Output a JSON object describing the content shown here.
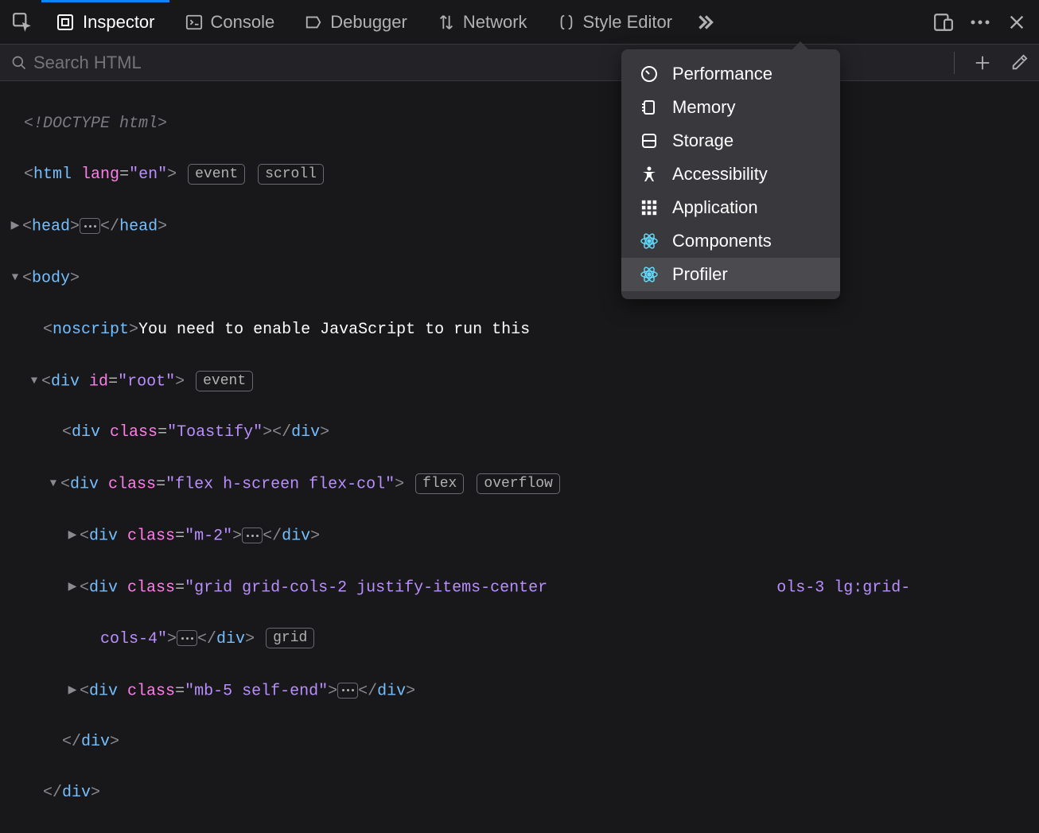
{
  "toolbar": {
    "tabs": [
      {
        "id": "inspector",
        "label": "Inspector",
        "active": true
      },
      {
        "id": "console",
        "label": "Console",
        "active": false
      },
      {
        "id": "debugger",
        "label": "Debugger",
        "active": false
      },
      {
        "id": "network",
        "label": "Network",
        "active": false
      },
      {
        "id": "styleeditor",
        "label": "Style Editor",
        "active": false
      }
    ]
  },
  "search": {
    "placeholder": "Search HTML"
  },
  "overflow_menu": {
    "items": [
      {
        "id": "performance",
        "label": "Performance",
        "icon": "gauge"
      },
      {
        "id": "memory",
        "label": "Memory",
        "icon": "memory"
      },
      {
        "id": "storage",
        "label": "Storage",
        "icon": "storage"
      },
      {
        "id": "accessibility",
        "label": "Accessibility",
        "icon": "accessibility"
      },
      {
        "id": "application",
        "label": "Application",
        "icon": "grid"
      },
      {
        "id": "components",
        "label": "Components",
        "icon": "react"
      },
      {
        "id": "profiler",
        "label": "Profiler",
        "icon": "react",
        "hover": true
      }
    ]
  },
  "markup": {
    "doctype": "<!DOCTYPE html>",
    "html_open": {
      "tag": "html",
      "attrs": [
        {
          "name": "lang",
          "value": "\"en\""
        }
      ],
      "badges": [
        "event",
        "scroll"
      ]
    },
    "head": {
      "tag": "head"
    },
    "body_open": {
      "tag": "body"
    },
    "noscript_text": "You need to enable JavaScript to run this",
    "div_root": {
      "tag": "div",
      "attrs": [
        {
          "name": "id",
          "value": "\"root\""
        }
      ],
      "badges": [
        "event"
      ]
    },
    "div_toastify": {
      "tag": "div",
      "attrs": [
        {
          "name": "class",
          "value": "\"Toastify\""
        }
      ]
    },
    "div_flex": {
      "tag": "div",
      "attrs": [
        {
          "name": "class",
          "value": "\"flex h-screen flex-col\""
        }
      ],
      "badges": [
        "flex",
        "overflow"
      ]
    },
    "div_m2": {
      "tag": "div",
      "attrs": [
        {
          "name": "class",
          "value": "\"m-2\""
        }
      ]
    },
    "div_grid": {
      "tag": "div",
      "attrs": [
        {
          "name": "class",
          "value": "\"grid grid-cols-2 justify-items-center"
        }
      ],
      "trailing": "ols-3 lg:grid-",
      "wrap": "cols-4\"",
      "badges": [
        "grid"
      ]
    },
    "div_mb5": {
      "tag": "div",
      "attrs": [
        {
          "name": "class",
          "value": "\"mb-5 self-end\""
        }
      ]
    }
  }
}
